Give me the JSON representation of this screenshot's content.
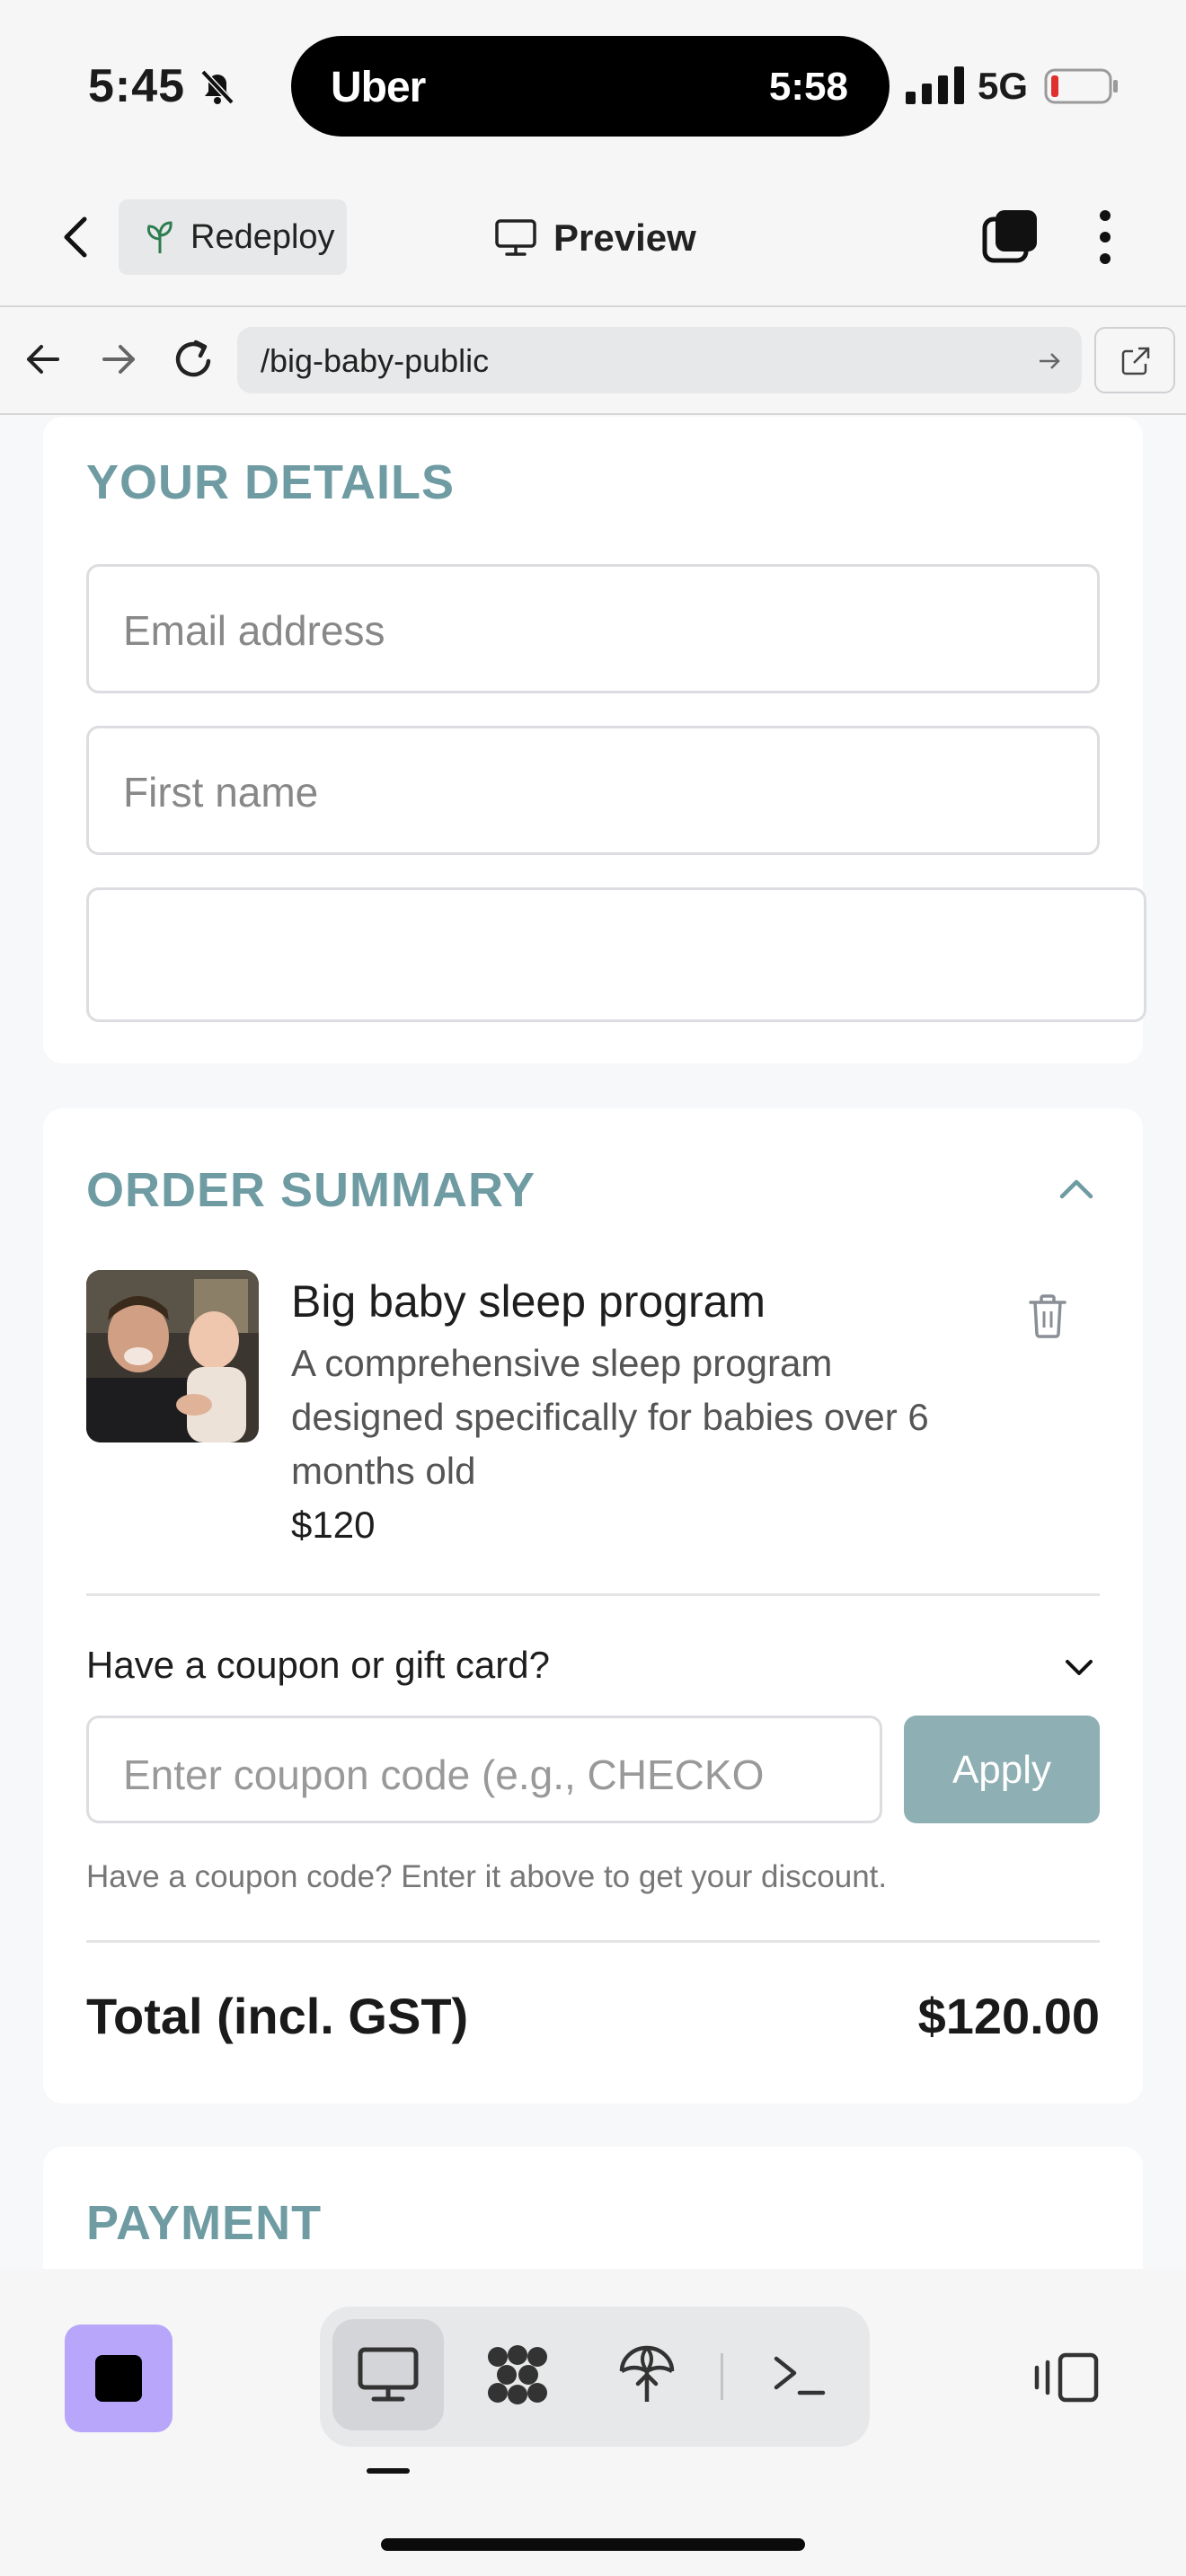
{
  "status_bar": {
    "time": "5:45",
    "island_app": "Uber",
    "island_time": "5:58",
    "network": "5G"
  },
  "toolbar": {
    "redeploy_label": "Redeploy",
    "preview_label": "Preview"
  },
  "browser": {
    "url": "/big-baby-public"
  },
  "details": {
    "title": "YOUR DETAILS",
    "email_placeholder": "Email address",
    "first_name_placeholder": "First name",
    "third_field_value": ""
  },
  "order": {
    "title": "ORDER SUMMARY",
    "product_name": "Big baby sleep program",
    "product_desc": "A comprehensive sleep program designed specifically for babies over 6 months old",
    "product_price": "$120",
    "coupon_question": "Have a coupon or gift card?",
    "coupon_placeholder": "Enter coupon code (e.g., CHECKO",
    "apply_label": "Apply",
    "helper": "Have a coupon code? Enter it above to get your discount.",
    "total_label": "Total (incl. GST)",
    "total_value": "$120.00"
  },
  "payment": {
    "title": "PAYMENT"
  },
  "colors": {
    "accent": "#6f9ba2",
    "apply_bg": "#8eafb3",
    "stop_bg": "#b8a6fb"
  },
  "icons": [
    "bell-slash-icon",
    "signal-icon",
    "battery-icon",
    "back-icon",
    "sprout-icon",
    "monitor-icon",
    "tabs-icon",
    "more-vertical-icon",
    "arrow-left-icon",
    "arrow-right-icon",
    "reload-icon",
    "external-link-icon",
    "chevron-up-icon",
    "trash-icon",
    "chevron-down-icon",
    "stop-icon",
    "terminal-icon",
    "panel-icon"
  ]
}
